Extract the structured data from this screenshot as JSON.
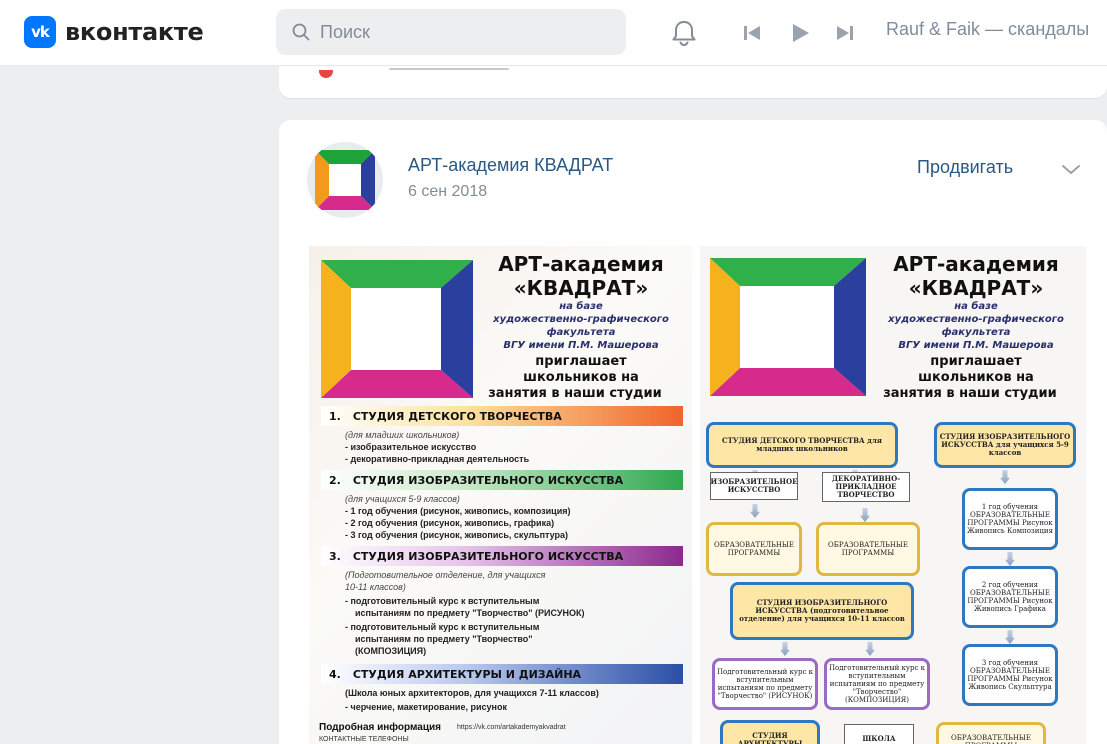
{
  "header": {
    "logo_mark": "vk",
    "logo_text": "вконтакте",
    "search_placeholder": "Поиск",
    "icons": [
      "search-icon",
      "bell-icon",
      "previous-track-icon",
      "play-icon",
      "next-track-icon"
    ],
    "now_playing": "Rauf & Faik — скандалы"
  },
  "post": {
    "author": "АРТ-академия КВАДРАТ",
    "date": "6 сен 2018",
    "promote_label": "Продвигать",
    "images": [
      {
        "title1": "АРТ-академия",
        "title2": "«КВАДРАТ»",
        "sub1": "на базе",
        "sub2": "художественно-графического",
        "sub3": "факультета",
        "sub4": "ВГУ имени П.М. Машерова",
        "bold1": "приглашает",
        "bold2": "школьников на",
        "bold3": "занятия в наши студии",
        "studios": [
          {
            "num": "1.",
            "name": "СТУДИЯ ДЕТСКОГО ТВОРЧЕСТВА",
            "color": "#f0642a",
            "lines": [
              "(для младших школьников)",
              "- изобразительное искусство",
              "- декоративно-прикладная деятельность"
            ]
          },
          {
            "num": "2.",
            "name": "СТУДИЯ ИЗОБРАЗИТЕЛЬНОГО ИСКУССТВА",
            "color": "#2fa84f",
            "lines": [
              "(для учащихся 5-9 классов)",
              "- 1 год обучения (рисунок, живопись, композиция)",
              "- 2 год обучения (рисунок, живопись, графика)",
              "- 3 год обучения (рисунок, живопись, скульптура)"
            ]
          },
          {
            "num": "3.",
            "name": "СТУДИЯ ИЗОБРАЗИТЕЛЬНОГО ИСКУССТВА",
            "color": "#8b2a8f",
            "lines": [
              "(Подготовительное отделение, для учащихся",
              "10-11 классов)",
              "- подготовительный курс к вступительным",
              "испытаниям по предмету \"Творчество\" (РИСУНОК)",
              "- подготовительный курс к вступительным",
              "испытаниям по предмету \"Творчество\"",
              "(КОМПОЗИЦИЯ)"
            ]
          },
          {
            "num": "4.",
            "name": "СТУДИЯ АРХИТЕКТУРЫ И ДИЗАЙНА",
            "color": "#2b4fa6",
            "lines": [
              "(Школа юных архитекторов, для учащихся 7-11 классов)",
              "- черчение, макетирование, рисунок"
            ]
          }
        ],
        "footer_label": "Подробная информация",
        "footer_link": "https://vk.com/artakademyakvadrat",
        "footer_phones": "КОНТАКТНЫЕ ТЕЛЕФОНЫ"
      },
      {
        "title1": "АРТ-академия",
        "title2": "«КВАДРАТ»",
        "sub1": "на базе",
        "sub2": "художественно-графического",
        "sub3": "факультета",
        "sub4": "ВГУ имени П.М. Машерова",
        "bold1": "приглашает",
        "bold2": "школьников на",
        "bold3": "занятия в наши студии",
        "boxes": {
          "b1": "СТУДИЯ ДЕТСКОГО ТВОРЧЕСТВА для младших школьников",
          "b2": "СТУДИЯ ИЗОБРАЗИТЕЛЬНОГО ИСКУССТВА для учащихся 5-9 классов",
          "b3": "ИЗОБРАЗИТЕЛЬНОЕ ИСКУССТВО",
          "b4": "ДЕКОРАТИВНО-ПРИКЛАДНОЕ ТВОРЧЕСТВО",
          "b5": "ОБРАЗОВАТЕЛЬНЫЕ ПРОГРАММЫ",
          "b6": "ОБРАЗОВАТЕЛЬНЫЕ ПРОГРАММЫ",
          "b7": "1 год обучения ОБРАЗОВАТЕЛЬНЫЕ ПРОГРАММЫ Рисунок Живопись Композиция",
          "b8": "СТУДИЯ ИЗОБРАЗИТЕЛЬНОГО ИСКУССТВА (подготовительное отделение) для учащихся 10-11 классов",
          "b9": "2 год обучения ОБРАЗОВАТЕЛЬНЫЕ ПРОГРАММЫ Рисунок Живопись Графика",
          "b10": "Подготовительный курс к вступительным испытаниям по предмету \"Творчество\" (РИСУНОК)",
          "b11": "Подготовительный курс к вступительным испытаниям по предмету \"Творчество\" (КОМПОЗИЦИЯ)",
          "b12": "3 год обучения ОБРАЗОВАТЕЛЬНЫЕ ПРОГРАММЫ Рисунок Живопись Скульптура",
          "b13": "СТУДИЯ АРХИТЕКТУРЫ",
          "b14": "ШКОЛА",
          "b15": "ОБРАЗОВАТЕЛЬНЫЕ ПРОГРАММЫ"
        }
      }
    ]
  }
}
